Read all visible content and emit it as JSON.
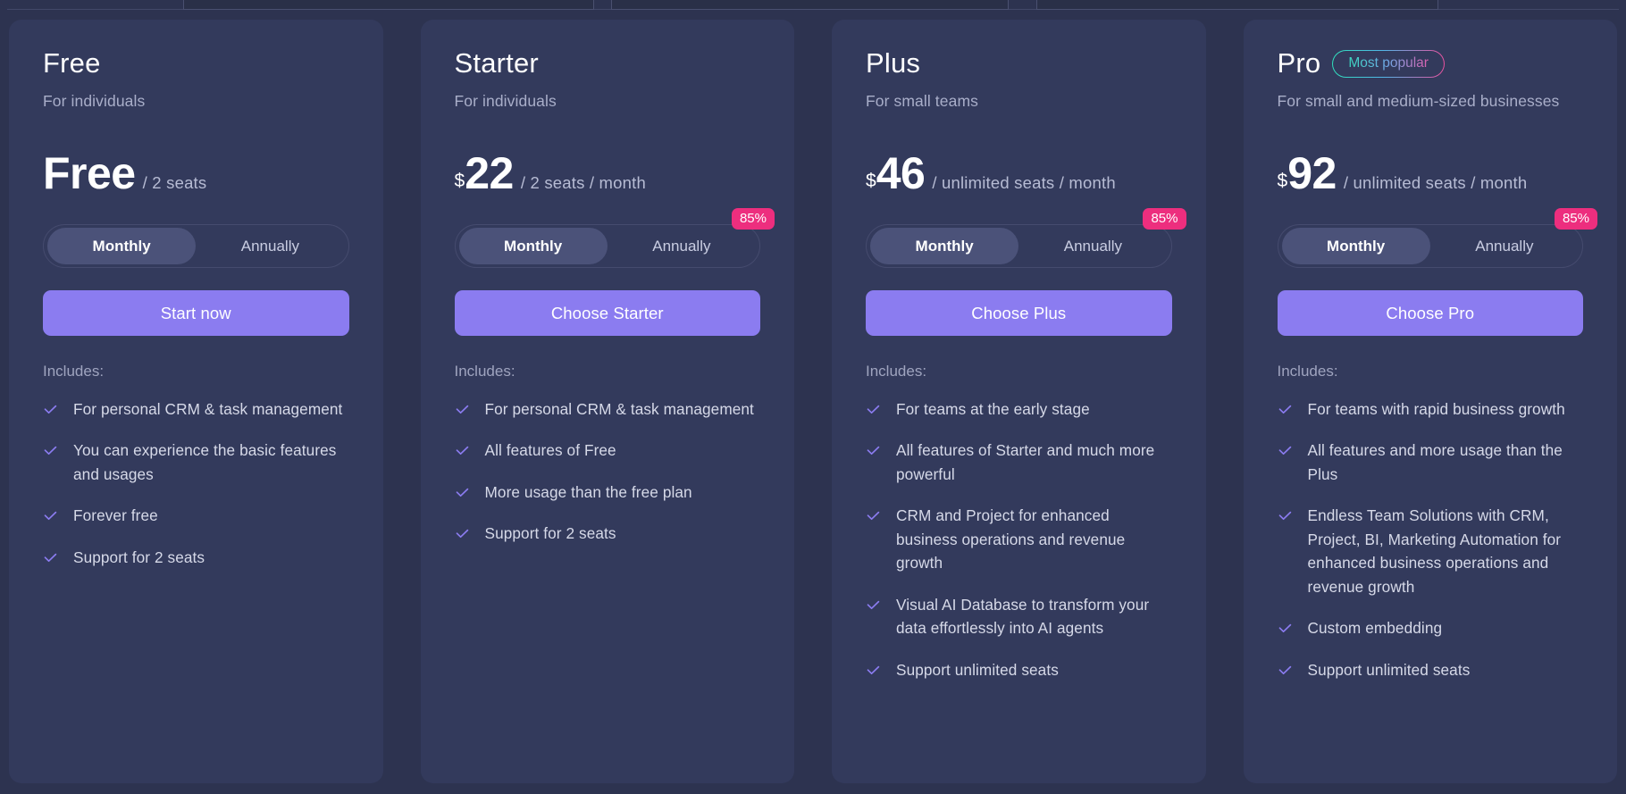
{
  "theme": {
    "page_bg": "#2d3350",
    "card_bg": "#333a5c",
    "accent_button": "#8b7cf0",
    "discount_badge": "#ed2e7e",
    "check_color": "#8b7cf0"
  },
  "labels": {
    "includes": "Includes:",
    "currency": "$",
    "toggle_monthly": "Monthly",
    "toggle_annually": "Annually",
    "discount": "85%",
    "most_popular": "Most popular"
  },
  "plans": [
    {
      "name": "Free",
      "subtitle": "For individuals",
      "badge": null,
      "currency": "",
      "amount": "Free",
      "unit": "/ 2  seats",
      "discount": null,
      "toggle": {
        "monthly": "Monthly",
        "annually": "Annually",
        "selected": "Monthly"
      },
      "cta": "Start now",
      "includes_label": "Includes:",
      "features": [
        "For personal CRM & task management",
        "You can experience the basic features and usages",
        "Forever free",
        "Support for 2 seats"
      ]
    },
    {
      "name": "Starter",
      "subtitle": "For individuals",
      "badge": null,
      "currency": "$",
      "amount": "22",
      "unit": "/ 2  seats  /  month",
      "discount": "85%",
      "toggle": {
        "monthly": "Monthly",
        "annually": "Annually",
        "selected": "Monthly"
      },
      "cta": "Choose Starter",
      "includes_label": "Includes:",
      "features": [
        "For personal CRM & task management",
        "All features of Free",
        "More usage than the free plan",
        "Support for 2 seats"
      ]
    },
    {
      "name": "Plus",
      "subtitle": "For small teams",
      "badge": null,
      "currency": "$",
      "amount": "46",
      "unit": "/ unlimited  seats  /  month",
      "discount": "85%",
      "toggle": {
        "monthly": "Monthly",
        "annually": "Annually",
        "selected": "Monthly"
      },
      "cta": "Choose Plus",
      "includes_label": "Includes:",
      "features": [
        "For teams at the early stage",
        "All features of Starter and much more powerful",
        "CRM and Project for enhanced business operations and revenue growth",
        "Visual AI Database to transform your data effortlessly into AI agents",
        "Support unlimited seats"
      ]
    },
    {
      "name": "Pro",
      "subtitle": "For small and medium-sized businesses",
      "badge": "Most popular",
      "currency": "$",
      "amount": "92",
      "unit": "/ unlimited  seats  /  month",
      "discount": "85%",
      "toggle": {
        "monthly": "Monthly",
        "annually": "Annually",
        "selected": "Monthly"
      },
      "cta": "Choose Pro",
      "includes_label": "Includes:",
      "features": [
        "For teams with rapid business growth",
        "All features and more usage than the Plus",
        "Endless Team Solutions with CRM, Project, BI, Marketing Automation for enhanced business operations and revenue growth",
        "Custom embedding",
        "Support unlimited seats"
      ]
    }
  ]
}
